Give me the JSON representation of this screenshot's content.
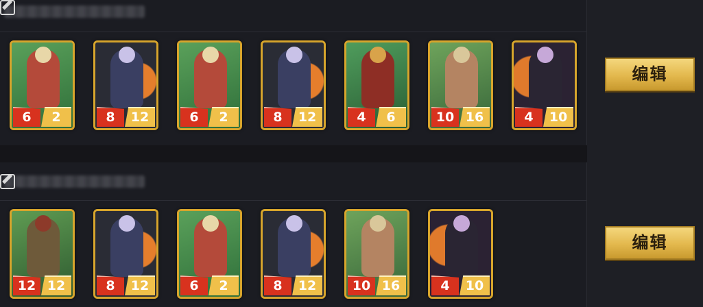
{
  "decks": [
    {
      "name": "",
      "edit_label": "编辑",
      "cards": [
        {
          "cost": "6",
          "power": "2",
          "theme": "green-warrior"
        },
        {
          "cost": "8",
          "power": "12",
          "theme": "dark-nobleman"
        },
        {
          "cost": "6",
          "power": "2",
          "theme": "green-warrior"
        },
        {
          "cost": "8",
          "power": "12",
          "theme": "dark-nobleman"
        },
        {
          "cost": "4",
          "power": "6",
          "theme": "green-beast"
        },
        {
          "cost": "10",
          "power": "16",
          "theme": "green-warrior-woman"
        },
        {
          "cost": "4",
          "power": "10",
          "theme": "orange-witch"
        }
      ]
    },
    {
      "name": "",
      "edit_label": "编辑",
      "cards": [
        {
          "cost": "12",
          "power": "12",
          "theme": "green-brute"
        },
        {
          "cost": "8",
          "power": "12",
          "theme": "dark-nobleman"
        },
        {
          "cost": "6",
          "power": "2",
          "theme": "green-warrior"
        },
        {
          "cost": "8",
          "power": "12",
          "theme": "dark-nobleman"
        },
        {
          "cost": "10",
          "power": "16",
          "theme": "green-warrior-woman"
        },
        {
          "cost": "4",
          "power": "10",
          "theme": "orange-witch"
        }
      ]
    }
  ],
  "colors": {
    "cost_badge": "#d8321e",
    "power_badge": "#f0c04a",
    "card_frame": "#d7a52c",
    "button_gold": "#e3b84d"
  },
  "icons": {
    "edit": "edit-icon"
  }
}
